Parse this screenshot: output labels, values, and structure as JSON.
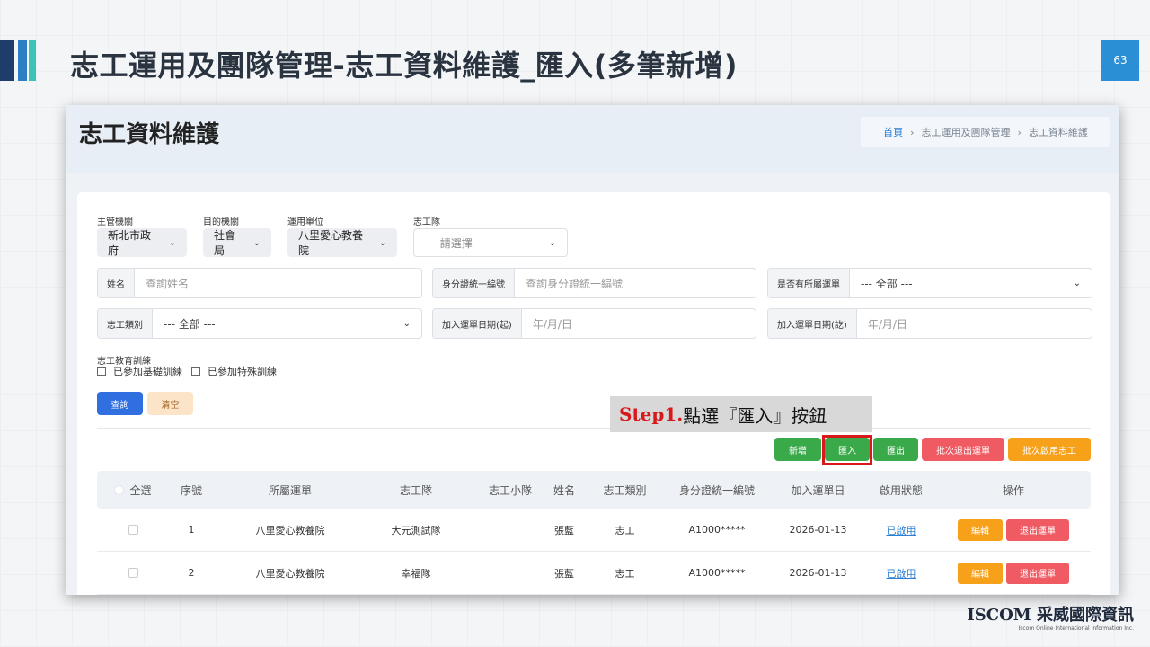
{
  "slide": {
    "title": "志工運用及團隊管理-志工資料維護_匯入(多筆新增)",
    "page_number": "63",
    "logo_text": "ISCOM 采威國際資訊",
    "logo_sub": "Iscom Online International Information Inc."
  },
  "header": {
    "title": "志工資料維護",
    "breadcrumb": [
      "首頁",
      "志工運用及團隊管理",
      "志工資料維護"
    ]
  },
  "filters": {
    "agency_label": "主管機關",
    "agency_value": "新北市政府",
    "purpose_label": "目的機關",
    "purpose_value": "社會局",
    "unit_label": "運用單位",
    "unit_value": "八里愛心教養院",
    "team_label": "志工隊",
    "team_placeholder": "--- 請選擇 ---",
    "name_label": "姓名",
    "name_placeholder": "查詢姓名",
    "id_label": "身分證統一編號",
    "id_placeholder": "查詢身分證統一編號",
    "has_unit_label": "是否有所屬運單",
    "has_unit_value": "--- 全部 ---",
    "type_label": "志工類別",
    "type_value": "--- 全部 ---",
    "join_start_label": "加入運單日期(起)",
    "join_start_placeholder": "年/月/日",
    "join_end_label": "加入運單日期(訖)",
    "join_end_placeholder": "年/月/日",
    "training_label": "志工教育訓練",
    "training_basic": "已參加基礎訓練",
    "training_special": "已參加特殊訓練"
  },
  "actions": {
    "query": "查詢",
    "clear": "清空",
    "add": "新增",
    "import": "匯入",
    "export": "匯出",
    "batch_out": "批次退出運單",
    "batch_on": "批次啟用志工"
  },
  "callout": {
    "step": "Step1.",
    "text": "點選『匯入』按鈕"
  },
  "table": {
    "headers": [
      "全選",
      "序號",
      "所屬運單",
      "志工隊",
      "志工小隊",
      "姓名",
      "志工類別",
      "身分證統一編號",
      "加入運單日",
      "啟用狀態",
      "操作"
    ],
    "rows": [
      {
        "no": "1",
        "unit": "八里愛心教養院",
        "team": "大元測試隊",
        "squad": "",
        "name": "張藍",
        "type": "志工",
        "id": "A1000*****",
        "date": "2026-01-13",
        "status": "已啟用",
        "edit": "編輯",
        "quit": "退出運單"
      },
      {
        "no": "2",
        "unit": "八里愛心教養院",
        "team": "幸福隊",
        "squad": "",
        "name": "張藍",
        "type": "志工",
        "id": "A1000*****",
        "date": "2026-01-13",
        "status": "已啟用",
        "edit": "編輯",
        "quit": "退出運單"
      }
    ]
  },
  "colors": {
    "primary": "#2f6fe0",
    "green": "#3aa94a",
    "red": "#f05a62",
    "orange": "#f7a11a",
    "highlight": "#d7191c"
  }
}
